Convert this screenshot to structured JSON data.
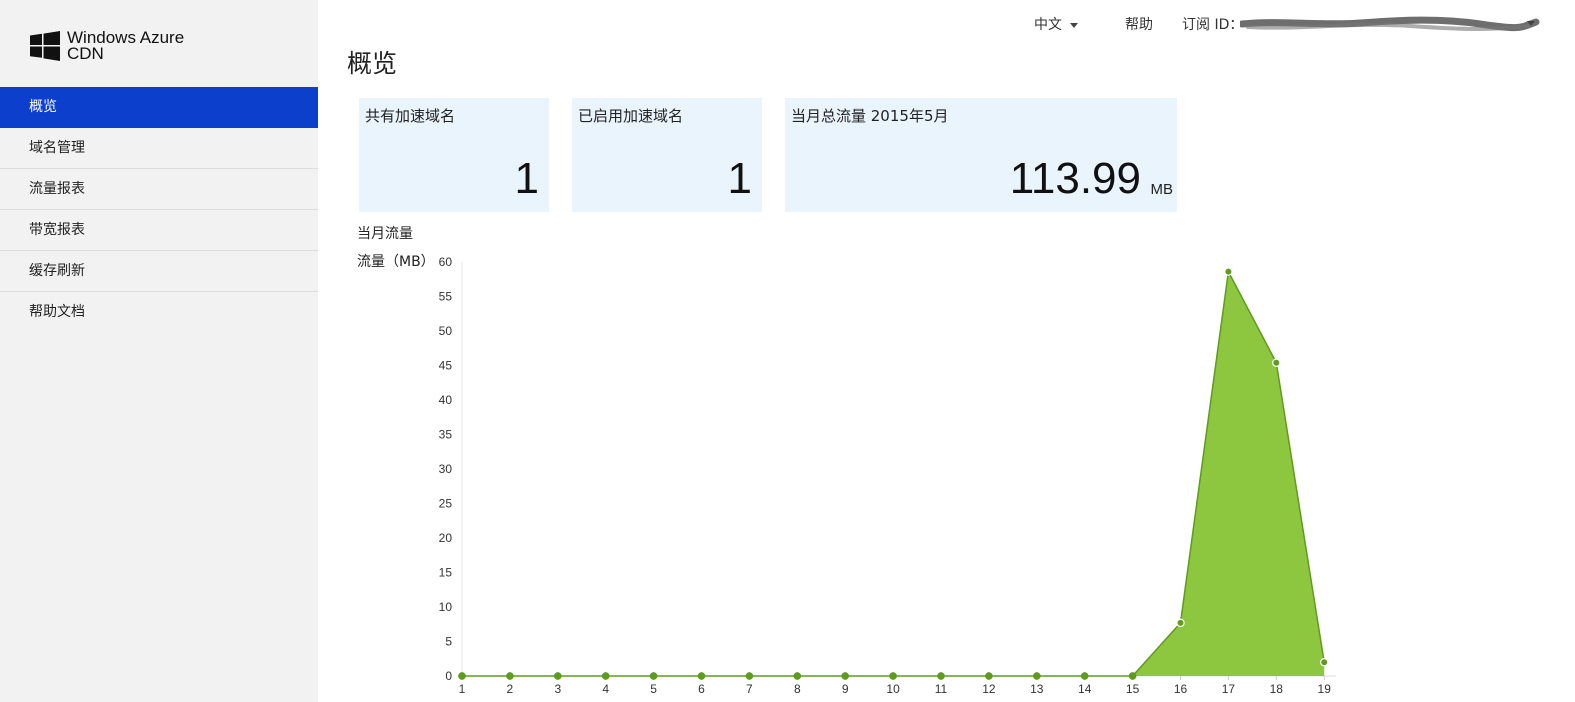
{
  "app": {
    "brand_line1": "Windows Azure",
    "brand_line2": "CDN"
  },
  "sidebar": {
    "items": [
      {
        "label": "概览",
        "active": true
      },
      {
        "label": "域名管理"
      },
      {
        "label": "流量报表"
      },
      {
        "label": "带宽报表"
      },
      {
        "label": "缓存刷新"
      },
      {
        "label": "帮助文档"
      }
    ]
  },
  "header": {
    "language": "中文",
    "help": "帮助",
    "subscription_label": "订阅 ID："
  },
  "page": {
    "title": "概览"
  },
  "cards": [
    {
      "label": "共有加速域名",
      "value": "1"
    },
    {
      "label": "已启用加速域名",
      "value": "1"
    },
    {
      "label": "当月总流量 2015年5月",
      "value": "113.99",
      "unit": "MB"
    }
  ],
  "colors": {
    "nav_active": "#0b3fcc",
    "card_bg": "#e9f4fd",
    "series_fill": "#8dc63f",
    "series_stroke": "#5f9b1e"
  },
  "chart_data": {
    "type": "area",
    "title": "当月流量",
    "ylabel": "流量（MB）",
    "xlabel": "",
    "x": [
      1,
      2,
      3,
      4,
      5,
      6,
      7,
      8,
      9,
      10,
      11,
      12,
      13,
      14,
      15,
      16,
      17,
      18,
      19
    ],
    "values": [
      0,
      0,
      0,
      0,
      0,
      0,
      0,
      0,
      0,
      0,
      0,
      0,
      0,
      0,
      0,
      7.7,
      58.6,
      45.4,
      2
    ],
    "ylim": [
      0,
      60
    ],
    "yticks": [
      0,
      5,
      10,
      15,
      20,
      25,
      30,
      35,
      40,
      45,
      50,
      55,
      60
    ],
    "grid": false
  }
}
